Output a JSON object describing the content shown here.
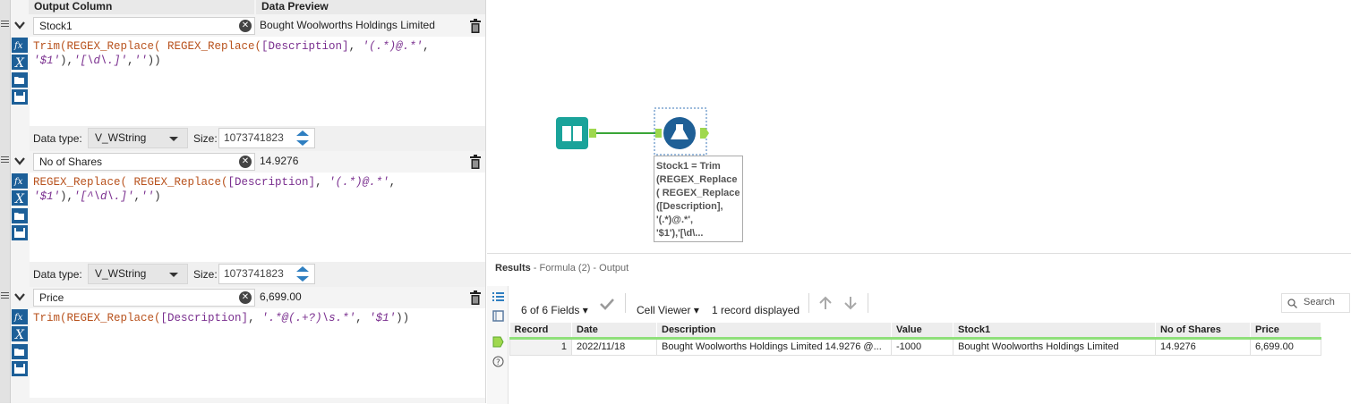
{
  "formula_panel": {
    "header_output_column": "Output Column",
    "header_data_preview": "Data Preview",
    "rows": [
      {
        "output_column": "Stock1",
        "data_preview": "Bought Woolworths Holdings Limited",
        "expression_line1_fn": "Trim(REGEX_Replace( REGEX_Replace(",
        "expression_line1_field": "[Description]",
        "expression_line1_sep": ", ",
        "expression_line1_str": "'(.*)@.*'",
        "expression_line1_end": ",",
        "expression_line2_str1": "'$1'",
        "expression_line2_sep": "),",
        "expression_line2_str2": "'[\\d\\.]'",
        "expression_line2_sep2": ",",
        "expression_line2_str3": "''",
        "expression_line2_end": "))",
        "data_type_label": "Data type:",
        "data_type": "V_WString",
        "size_label": "Size:",
        "size": "1073741823"
      },
      {
        "output_column": "No of Shares",
        "data_preview": "14.9276",
        "expression_line1_fn": "REGEX_Replace( REGEX_Replace(",
        "expression_line1_field": "[Description]",
        "expression_line1_sep": ", ",
        "expression_line1_str": "'(.*)@.*'",
        "expression_line1_end": ",",
        "expression_line2_str1": "'$1'",
        "expression_line2_sep": "),",
        "expression_line2_str2": "'[^\\d\\.]'",
        "expression_line2_sep2": ",",
        "expression_line2_str3": "''",
        "expression_line2_end": ")",
        "data_type_label": "Data type:",
        "data_type": "V_WString",
        "size_label": "Size:",
        "size": "1073741823"
      },
      {
        "output_column": "Price",
        "data_preview": "6,699.00",
        "expression_line1_fn": "Trim(REGEX_Replace(",
        "expression_line1_field": "[Description]",
        "expression_line1_sep": ", ",
        "expression_line1_str": "'.*@(.+?)\\s.*'",
        "expression_line1_sep2": ", ",
        "expression_line1_str2": "'$1'",
        "expression_line1_end": "))"
      }
    ]
  },
  "canvas": {
    "annotation": "Stock1 = Trim\n(REGEX_Replace\n( REGEX_Replace\n([Description],\n'(.*)@.*',\n'$1'),'[\\d\\...",
    "input_tool_icon": "book-icon",
    "formula_tool_icon": "flask-icon",
    "colors": {
      "input_tool": "#1aa39a",
      "formula_tool": "#1e5f96",
      "connector": "#3aa537",
      "anchor": "#9fd84e"
    }
  },
  "results": {
    "title_bold": "Results",
    "title_rest": " - Formula (2) - Output",
    "fields_count": "6 of 6 Fields",
    "cell_viewer": "Cell Viewer",
    "records_displayed": "1 record displayed",
    "search": "Search",
    "columns": [
      "Record",
      "Date",
      "Description",
      "Value",
      "Stock1",
      "No of Shares",
      "Price"
    ],
    "rows": [
      {
        "record": "1",
        "date": "2022/11/18",
        "description": "Bought Woolworths Holdings Limited 14.9276 @...",
        "value": "-1000",
        "stock1": "Bought Woolworths Holdings Limited",
        "shares": "14.9276",
        "price": "6,699.00"
      }
    ]
  }
}
